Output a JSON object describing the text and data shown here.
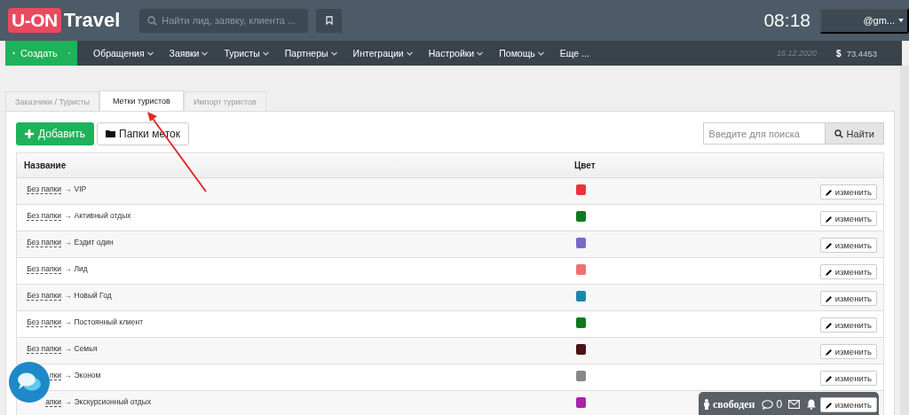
{
  "header": {
    "logo_badge": "U-ON",
    "logo_text": "Travel",
    "search": {
      "placeholder": "Найти лид, заявку, клиента ..."
    },
    "time": "08:18",
    "user": "@gm..."
  },
  "nav": {
    "create": "Создать",
    "items": [
      "Обращения",
      "Заявки",
      "Туристы",
      "Партнеры",
      "Интеграции",
      "Настройки",
      "Помощь"
    ],
    "more": "Еще ...",
    "date": "16.12.2020",
    "currency": "$",
    "rate": "73.4453"
  },
  "tabs": [
    {
      "label": "Заказчики / Туристы",
      "selected": false
    },
    {
      "label": "Метки туристов",
      "selected": true
    },
    {
      "label": "Импорт туристов",
      "selected": false
    }
  ],
  "toolbar": {
    "add": "Добавить",
    "folders": "Папки меток",
    "search": {
      "placeholder": "Введите для поиска"
    },
    "find": "Найти"
  },
  "table": {
    "columns": [
      "Название",
      "Цвет"
    ],
    "rows": [
      {
        "folder": "Без папки",
        "separator": "→",
        "name": "VIP",
        "color": "#e8333a",
        "action": "изменить"
      },
      {
        "folder": "Без папки",
        "separator": "→",
        "name": "Активный отдых",
        "color": "#0b7a1e",
        "action": "изменить"
      },
      {
        "folder": "Без папки",
        "separator": "→",
        "name": "Ездит один",
        "color": "#7a68c6",
        "action": "изменить"
      },
      {
        "folder": "Без папки",
        "separator": "→",
        "name": "Лид",
        "color": "#ef7070",
        "action": "изменить"
      },
      {
        "folder": "Без папки",
        "separator": "→",
        "name": "Новый Год",
        "color": "#1888aa",
        "action": "изменить"
      },
      {
        "folder": "Без папки",
        "separator": "→",
        "name": "Постоянный клиент",
        "color": "#0b7a1e",
        "action": "изменить"
      },
      {
        "folder": "Без папки",
        "separator": "→",
        "name": "Семья",
        "color": "#4a1212",
        "action": "изменить"
      },
      {
        "folder": "пки",
        "separator": "→",
        "name": "Эконом",
        "color": "#888888",
        "action": "изменить"
      },
      {
        "folder": "апки",
        "separator": "→",
        "name": "Экскурсионный отдых",
        "color": "#aa22aa",
        "action": "изменить"
      }
    ]
  },
  "status_bar": {
    "status": "свободен",
    "messages": "0"
  }
}
